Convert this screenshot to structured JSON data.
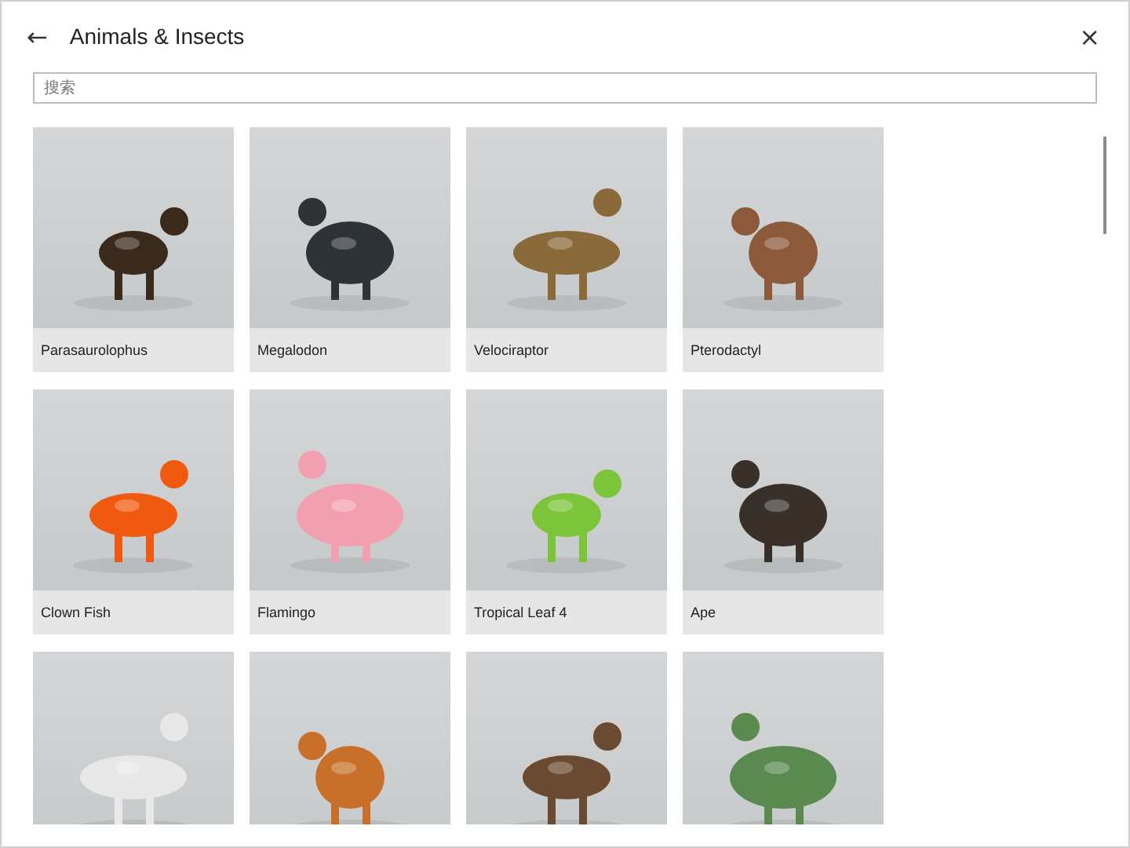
{
  "window": {
    "title": "Animals & Insects",
    "back": "←",
    "close": "×"
  },
  "search": {
    "placeholder": "搜索"
  },
  "models": [
    {
      "kind": "labeled",
      "label": "Parasaurolophus"
    },
    {
      "kind": "labeled",
      "label": "Megalodon"
    },
    {
      "kind": "labeled",
      "label": "Velociraptor"
    },
    {
      "kind": "labeled",
      "label": "Pterodactyl"
    },
    {
      "kind": "labeled",
      "label": "Clown Fish"
    },
    {
      "kind": "labeled",
      "label": "Flamingo"
    },
    {
      "kind": "labeled",
      "label": "Tropical Leaf 4"
    },
    {
      "kind": "labeled",
      "label": "Ape"
    },
    {
      "kind": "picture"
    },
    {
      "kind": "picture"
    },
    {
      "kind": "picture"
    },
    {
      "kind": "picture"
    }
  ]
}
